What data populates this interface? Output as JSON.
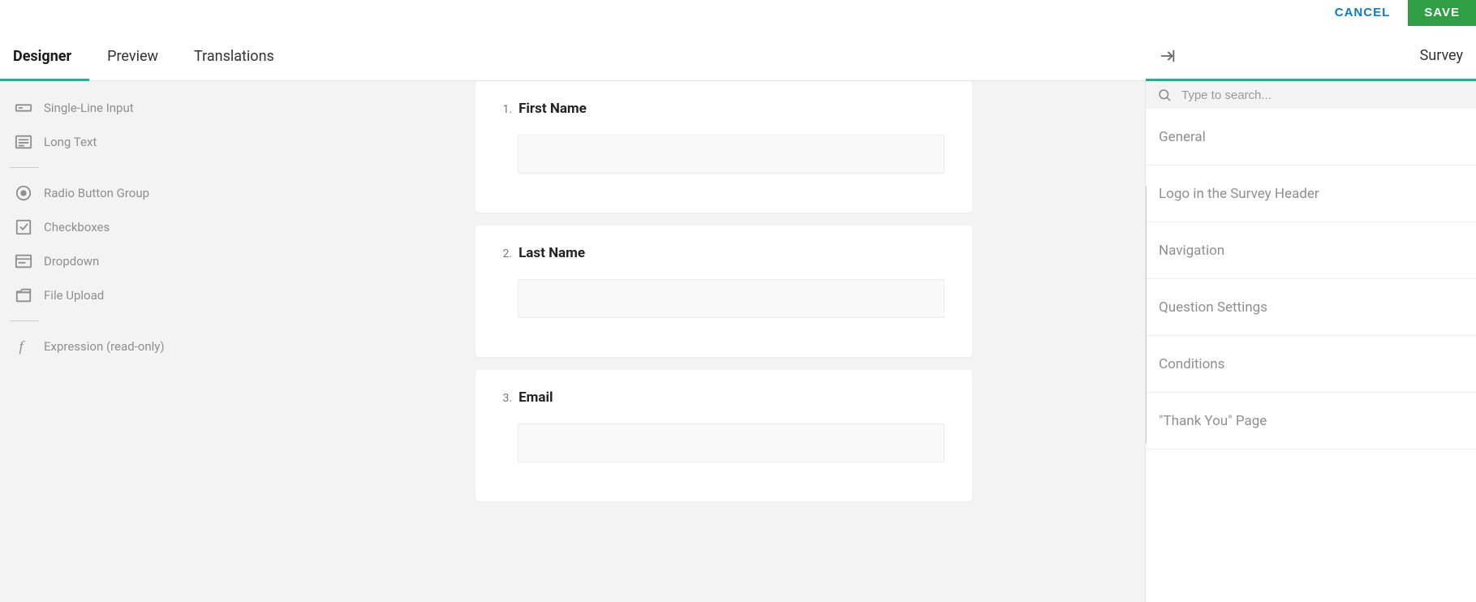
{
  "topActions": {
    "cancel": "CANCEL",
    "save": "SAVE"
  },
  "tabs": [
    {
      "id": "designer",
      "label": "Designer",
      "active": true
    },
    {
      "id": "preview",
      "label": "Preview",
      "active": false
    },
    {
      "id": "translations",
      "label": "Translations",
      "active": false
    }
  ],
  "toolbox": {
    "groups": [
      [
        {
          "id": "single-line",
          "icon": "text-input",
          "label": "Single-Line Input"
        },
        {
          "id": "long-text",
          "icon": "long-text",
          "label": "Long Text"
        }
      ],
      [
        {
          "id": "radio",
          "icon": "radio",
          "label": "Radio Button Group"
        },
        {
          "id": "checkbox",
          "icon": "checkbox",
          "label": "Checkboxes"
        },
        {
          "id": "dropdown",
          "icon": "dropdown",
          "label": "Dropdown"
        },
        {
          "id": "file",
          "icon": "file",
          "label": "File Upload"
        }
      ],
      [
        {
          "id": "expression",
          "icon": "function",
          "label": "Expression (read-only)"
        }
      ]
    ]
  },
  "questions": [
    {
      "num": "1.",
      "title": "First Name"
    },
    {
      "num": "2.",
      "title": "Last Name"
    },
    {
      "num": "3.",
      "title": "Email"
    }
  ],
  "rightPanel": {
    "title": "Survey",
    "searchPlaceholder": "Type to search...",
    "sections": [
      "General",
      "Logo in the Survey Header",
      "Navigation",
      "Question Settings",
      "Conditions",
      "\"Thank You\" Page"
    ]
  }
}
